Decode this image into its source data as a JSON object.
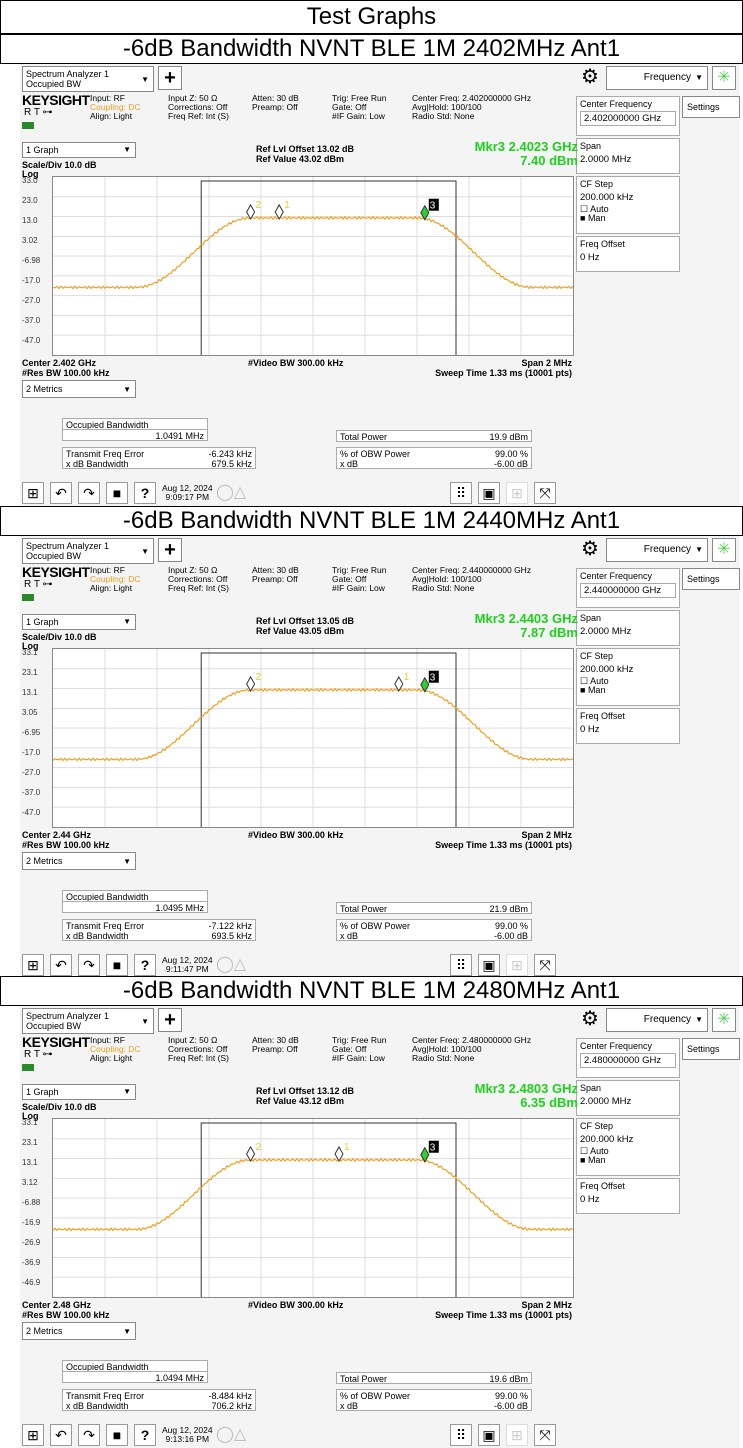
{
  "page_title": "Test Graphs",
  "common": {
    "window_line1": "Spectrum Analyzer 1",
    "window_line2": "Occupied BW",
    "plus": "+",
    "freq_menu": "Frequency",
    "brand": "KEYSIGHT",
    "rt": "R  T",
    "input": "Input: RF",
    "coupling": "Coupling: DC",
    "align": "Align: Light",
    "inputz": "Input Z: 50 Ω",
    "corrections": "Corrections: Off",
    "freqref": "Freq Ref: Int (S)",
    "atten": "Atten: 30 dB",
    "preamp": "Preamp: Off",
    "trig": "Trig: Free Run",
    "gate": "Gate: Off",
    "ifgain": "#IF Gain: Low",
    "avg": "Avg|Hold: 100/100",
    "radio": "Radio Std: None",
    "settings": "Settings",
    "center_freq_label": "Center Frequency",
    "span_label": "Span",
    "span_val": "2.0000 MHz",
    "cfstep_label": "CF Step",
    "cfstep_val": "200.000 kHz",
    "auto": "Auto",
    "man": "Man",
    "freqoffset_label": "Freq Offset",
    "freqoffset_val": "0 Hz",
    "graph_sel": "1 Graph",
    "scale": "Scale/Div 10.0 dB",
    "log": "Log",
    "vbw": "#Video BW 300.00 kHz",
    "span_bottom": "Span 2 MHz",
    "rbw": "#Res BW 100.00 kHz",
    "sweep": "Sweep Time 1.33 ms (10001 pts)",
    "metrics_sel": "2 Metrics",
    "obw_label": "Occupied Bandwidth",
    "tfe_label": "Transmit Freq Error",
    "xdbbw_label": "x dB Bandwidth",
    "totpow_label": "Total Power",
    "obwpct_label": "% of OBW Power",
    "xdb_label": "x dB",
    "obwpct_val": "99.00 %",
    "xdb_val": "-6.00 dB",
    "help": "?"
  },
  "panels": [
    {
      "section_title": "-6dB Bandwidth NVNT BLE 1M 2402MHz Ant1",
      "center_freq_info": "Center Freq: 2.402000000 GHz",
      "center_freq_val": "2.402000000 GHz",
      "ref_offset": "Ref Lvl Offset 13.02 dB",
      "ref_value": "Ref Value 43.02 dBm",
      "mkr_freq": "Mkr3  2.4023 GHz",
      "mkr_amp": "7.40 dBm",
      "yticks": [
        "33.0",
        "23.0",
        "13.0",
        "3.02",
        "-6.98",
        "-17.0",
        "-27.0",
        "-37.0",
        "-47.0"
      ],
      "center_bottom": "Center 2.402 GHz",
      "obw_val": "1.0491 MHz",
      "tfe_val": "-6.243 kHz",
      "xdbbw_val": "679.5 kHz",
      "totpow_val": "19.9 dBm",
      "date": "Aug 12, 2024",
      "time": "9:09:17 PM",
      "markers": [
        {
          "label": "2",
          "x": 0.38
        },
        {
          "label": "1",
          "x": 0.435
        },
        {
          "label": "3",
          "x": 0.715
        }
      ]
    },
    {
      "section_title": "-6dB Bandwidth NVNT BLE 1M 2440MHz Ant1",
      "center_freq_info": "Center Freq: 2.440000000 GHz",
      "center_freq_val": "2.440000000 GHz",
      "ref_offset": "Ref Lvl Offset 13.05 dB",
      "ref_value": "Ref Value 43.05 dBm",
      "mkr_freq": "Mkr3  2.4403 GHz",
      "mkr_amp": "7.87 dBm",
      "yticks": [
        "33.1",
        "23.1",
        "13.1",
        "3.05",
        "-6.95",
        "-17.0",
        "-27.0",
        "-37.0",
        "-47.0"
      ],
      "center_bottom": "Center 2.44 GHz",
      "obw_val": "1.0495 MHz",
      "tfe_val": "-7.122 kHz",
      "xdbbw_val": "693.5 kHz",
      "totpow_val": "21.9 dBm",
      "date": "Aug 12, 2024",
      "time": "9:11:47 PM",
      "markers": [
        {
          "label": "2",
          "x": 0.38
        },
        {
          "label": "1",
          "x": 0.665
        },
        {
          "label": "3",
          "x": 0.715
        }
      ]
    },
    {
      "section_title": "-6dB Bandwidth NVNT BLE 1M 2480MHz Ant1",
      "center_freq_info": "Center Freq: 2.480000000 GHz",
      "center_freq_val": "2.480000000 GHz",
      "ref_offset": "Ref Lvl Offset 13.12 dB",
      "ref_value": "Ref Value 43.12 dBm",
      "mkr_freq": "Mkr3  2.4803 GHz",
      "mkr_amp": "6.35 dBm",
      "yticks": [
        "33.1",
        "23.1",
        "13.1",
        "3.12",
        "-6.88",
        "-16.9",
        "-26.9",
        "-36.9",
        "-46.9"
      ],
      "center_bottom": "Center 2.48 GHz",
      "obw_val": "1.0494 MHz",
      "tfe_val": "-8.484 kHz",
      "xdbbw_val": "706.2 kHz",
      "totpow_val": "19.6 dBm",
      "date": "Aug 12, 2024",
      "time": "9:13:16 PM",
      "markers": [
        {
          "label": "2",
          "x": 0.38
        },
        {
          "label": "1",
          "x": 0.55
        },
        {
          "label": "3",
          "x": 0.715
        }
      ]
    }
  ]
}
